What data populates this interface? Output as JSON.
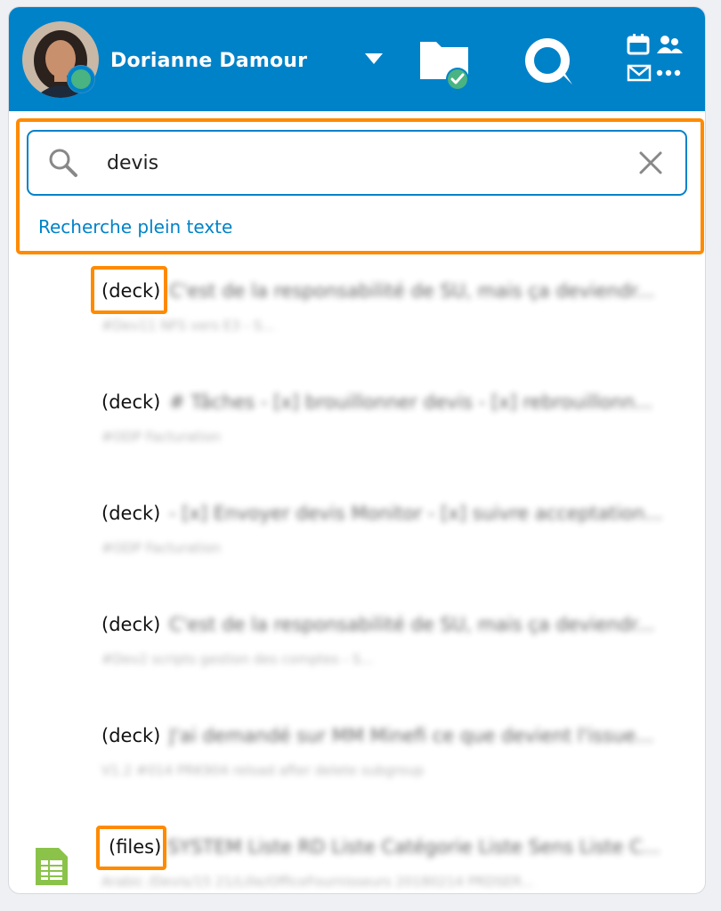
{
  "header": {
    "user_name": "Dorianne Damour",
    "status": "online",
    "icons": [
      "user-menu-caret",
      "files-synced-folder-icon",
      "talk-icon",
      "calendar-contacts-mail-apps-icon"
    ],
    "colors": {
      "header_bg": "#0082c9",
      "status_dot": "#49b382",
      "sync_check": "#49b382"
    }
  },
  "search": {
    "value": "devis",
    "placeholder": "",
    "fulltext_label": "Recherche plein texte"
  },
  "results": [
    {
      "type": "(deck)",
      "title": "C'est de la responsabilité de SU, mais ça deviendr...",
      "sub": "#Dev11 NFS vers E3 - S..."
    },
    {
      "type": "(deck)",
      "title": "# Tâches - [x] brouillonner devis - [x] rebrouillonn...",
      "sub": "#ODP Facturation"
    },
    {
      "type": "(deck)",
      "title": "- [x] Envoyer devis Monitor - [x] suivre acceptation...",
      "sub": "#ODP Facturation"
    },
    {
      "type": "(deck)",
      "title": "C'est de la responsabilité de SU, mais ça deviendr...",
      "sub": "#Dev2 scripts gestion des comptes - S..."
    },
    {
      "type": "(deck)",
      "title": "J'ai demandé sur MM Minefi ce que devient l'issue...",
      "sub": "V1.2 #014 PRK904 reload after delete subgroup"
    },
    {
      "type": "(files)",
      "title": "SYSTEM Liste RD Liste Catégorie Liste Sens Liste C...",
      "sub": "Arabic /Devis/15 21/Lille/OfficeFournisseurs 20180214 PRDSER..."
    }
  ],
  "colors": {
    "highlight": "#ff8a00",
    "accent": "#0082c9",
    "sheet_icon": "#8bc34a"
  }
}
